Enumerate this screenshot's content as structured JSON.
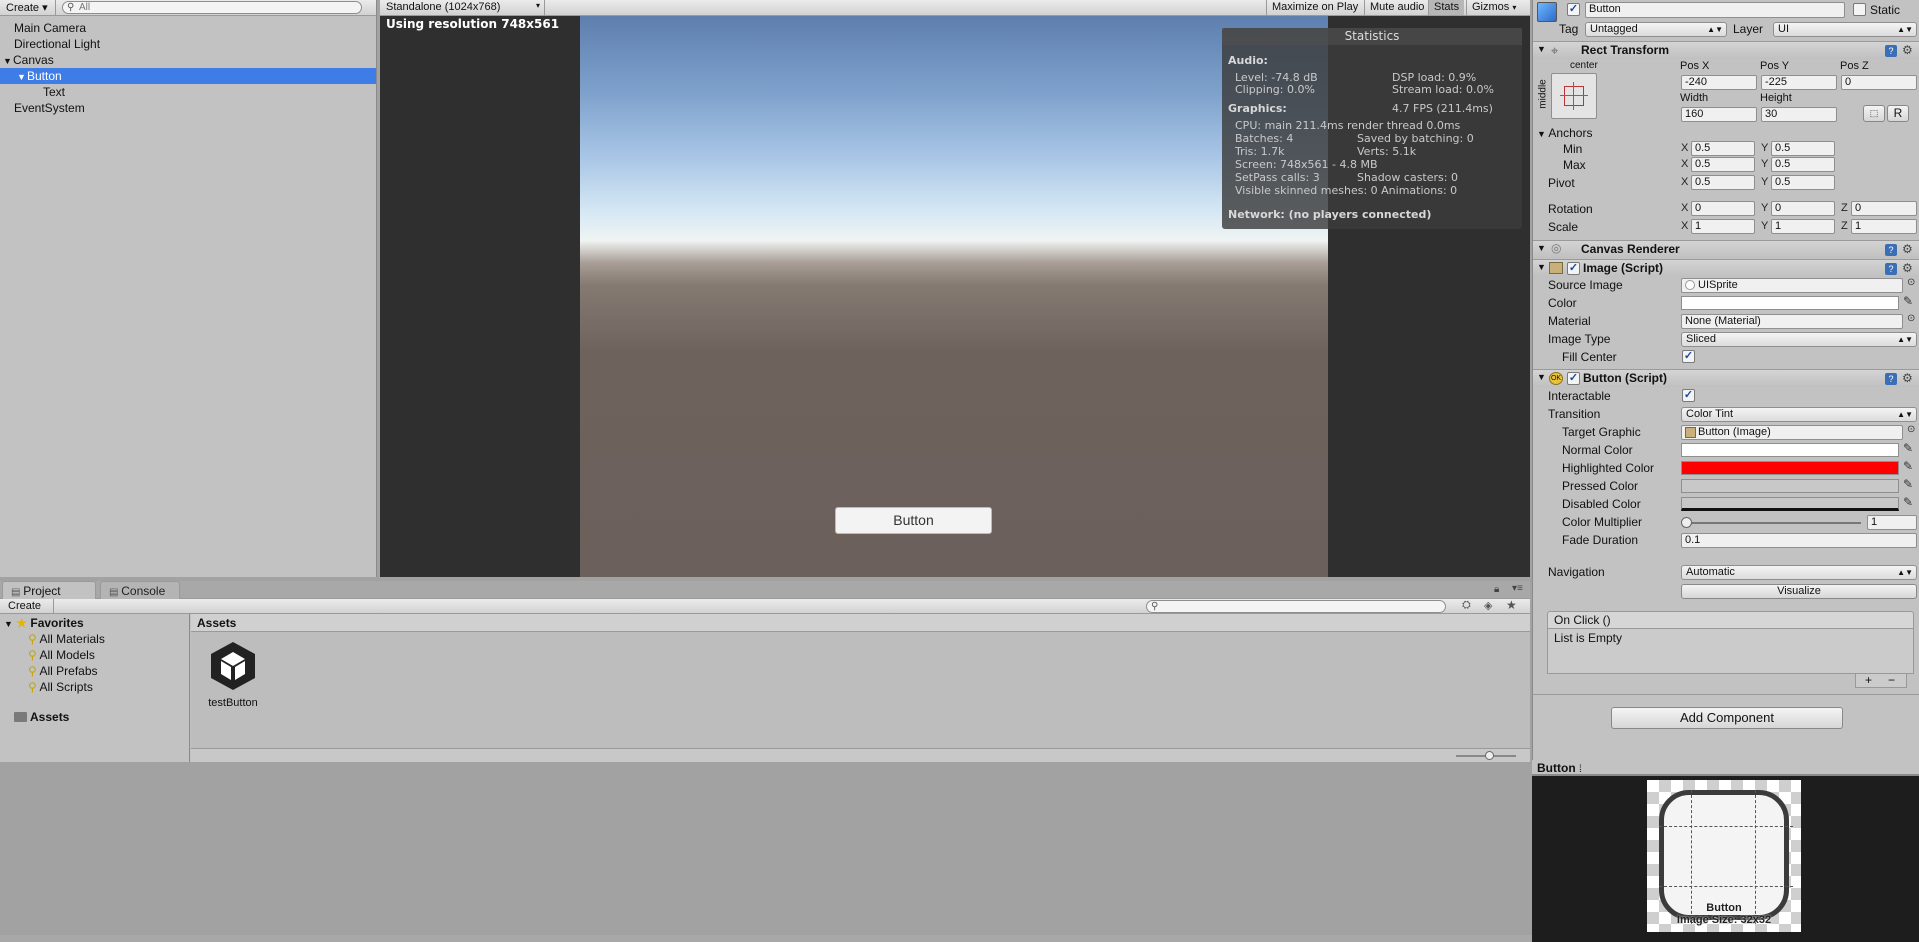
{
  "hierarchy": {
    "create_label": "Create",
    "search_placeholder": "All",
    "items": [
      {
        "label": "Main Camera"
      },
      {
        "label": "Directional Light"
      },
      {
        "label": "Canvas"
      },
      {
        "label": "Button"
      },
      {
        "label": "Text"
      },
      {
        "label": "EventSystem"
      }
    ]
  },
  "game": {
    "aspect_label": "Standalone (1024x768)",
    "maximize_label": "Maximize on Play",
    "mute_label": "Mute audio",
    "stats_label": "Stats",
    "gizmos_label": "Gizmos",
    "resolution_text": "Using resolution 748x561",
    "button_label": "Button",
    "stats": {
      "title": "Statistics",
      "audio_header": "Audio:",
      "level": "Level: -74.8 dB",
      "dsp": "DSP load: 0.9%",
      "clipping": "Clipping: 0.0%",
      "stream": "Stream load: 0.0%",
      "graphics_header": "Graphics:",
      "fps": "4.7 FPS (211.4ms)",
      "cpu": "CPU: main 211.4ms  render thread 0.0ms",
      "batches": "Batches: 4",
      "saved": "Saved by batching: 0",
      "tris": "Tris: 1.7k",
      "verts": "Verts: 5.1k",
      "screen": "Screen: 748x561 - 4.8 MB",
      "setpass": "SetPass calls: 3",
      "shadow": "Shadow casters: 0",
      "skinned": "Visible skinned meshes: 0  Animations: 0",
      "network": "Network: (no players connected)"
    }
  },
  "inspector": {
    "object_name": "Button",
    "static_label": "Static",
    "tag_label": "Tag",
    "tag_value": "Untagged",
    "layer_label": "Layer",
    "layer_value": "UI",
    "rect_transform": {
      "title": "Rect Transform",
      "anchor_preset_h": "center",
      "anchor_preset_v": "middle",
      "posx_label": "Pos X",
      "posy_label": "Pos Y",
      "posz_label": "Pos Z",
      "posx": "-240",
      "posy": "-225",
      "posz": "0",
      "width_label": "Width",
      "height_label": "Height",
      "width": "160",
      "height": "30",
      "r_label": "R",
      "anchors_label": "Anchors",
      "min_label": "Min",
      "max_label": "Max",
      "min_x": "0.5",
      "min_y": "0.5",
      "max_x": "0.5",
      "max_y": "0.5",
      "pivot_label": "Pivot",
      "pivot_x": "0.5",
      "pivot_y": "0.5",
      "rotation_label": "Rotation",
      "rot_x": "0",
      "rot_y": "0",
      "rot_z": "0",
      "scale_label": "Scale",
      "scale_x": "1",
      "scale_y": "1",
      "scale_z": "1",
      "x": "X",
      "y": "Y",
      "z": "Z"
    },
    "canvas_renderer": {
      "title": "Canvas Renderer"
    },
    "image": {
      "title": "Image (Script)",
      "source_label": "Source Image",
      "source_value": "UISprite",
      "color_label": "Color",
      "color_value": "#ffffff",
      "material_label": "Material",
      "material_value": "None (Material)",
      "type_label": "Image Type",
      "type_value": "Sliced",
      "fill_label": "Fill Center"
    },
    "button": {
      "title": "Button (Script)",
      "interactable_label": "Interactable",
      "transition_label": "Transition",
      "transition_value": "Color Tint",
      "target_label": "Target Graphic",
      "target_value": "Button (Image)",
      "normal_label": "Normal Color",
      "normal_color": "#ffffff",
      "highlighted_label": "Highlighted Color",
      "highlighted_color": "#ff0000",
      "pressed_label": "Pressed Color",
      "pressed_color": "#c8c8c8",
      "disabled_label": "Disabled Color",
      "disabled_color": "#c8c8c8",
      "multiplier_label": "Color Multiplier",
      "multiplier_value": "1",
      "fade_label": "Fade Duration",
      "fade_value": "0.1",
      "navigation_label": "Navigation",
      "navigation_value": "Automatic",
      "visualize_label": "Visualize",
      "onclick_label": "On Click ()",
      "list_empty": "List is Empty",
      "plus": "+",
      "minus": "−"
    },
    "add_component": "Add Component"
  },
  "project": {
    "tab_project": "Project",
    "tab_console": "Console",
    "create_label": "Create",
    "favorites_label": "Favorites",
    "favorites": [
      "All Materials",
      "All Models",
      "All Prefabs",
      "All Scripts"
    ],
    "assets_root": "Assets",
    "assets_header": "Assets",
    "asset_items": [
      {
        "name": "testButton",
        "icon": "unity-logo-icon"
      }
    ]
  },
  "preview": {
    "title": "Button",
    "caption_name": "Button",
    "caption_size": "Image Size: 32x32"
  }
}
